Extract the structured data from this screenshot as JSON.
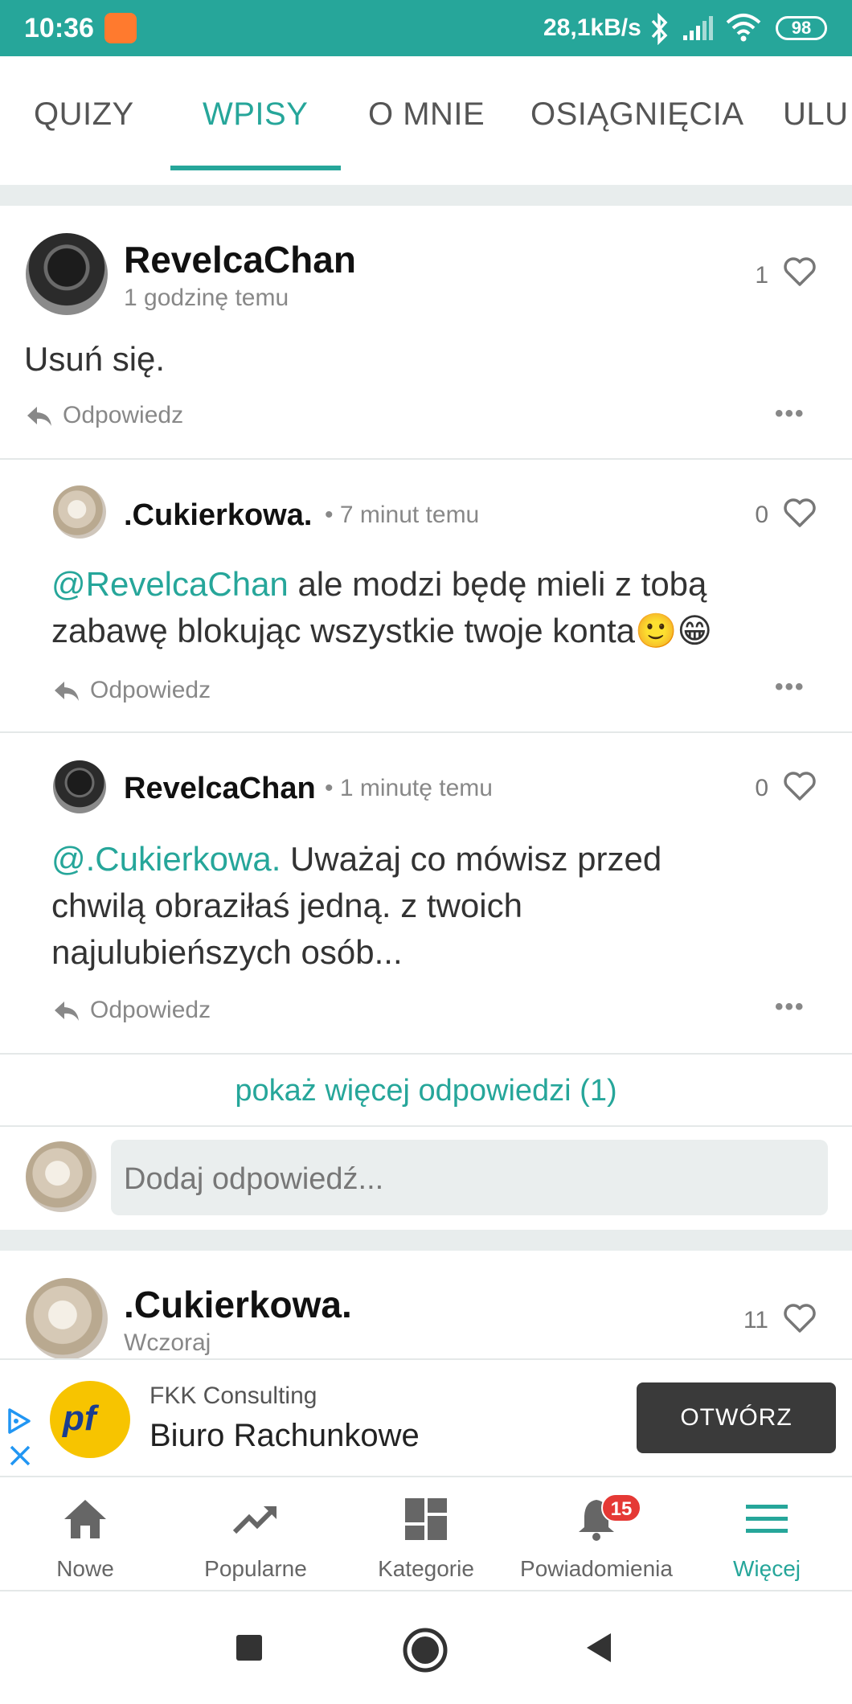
{
  "status_bar": {
    "time": "10:36",
    "network_speed": "28,1kB/s",
    "battery": "98",
    "background_color": "#26a69a"
  },
  "tabs": [
    {
      "label": "QUIZY"
    },
    {
      "label": "WPISY",
      "active": true
    },
    {
      "label": "O MNIE"
    },
    {
      "label": "OSIĄGNIĘCIA"
    },
    {
      "label": "ULU"
    }
  ],
  "post": {
    "author": "RevelcaChan",
    "time": "1 godzinę temu",
    "likes": "1",
    "text": "Usuń się.",
    "reply_label": "Odpowiedz",
    "more_icon": "more-horizontal-icon"
  },
  "replies": [
    {
      "author": ".Cukierkowa.",
      "time": "• 7 minut temu",
      "likes": "0",
      "mention": "@RevelcaChan",
      "text": " ale modzi będę mieli z tobą zabawę blokując wszystkie twoje konta🙂😁",
      "reply_label": "Odpowiedz"
    },
    {
      "author": "RevelcaChan",
      "time": "• 1 minutę temu",
      "likes": "0",
      "mention": "@.Cukierkowa.",
      "text": " Uważaj co mówisz przed chwilą obraziłaś jedną. z twoich najulubieńszych osób...",
      "reply_label": "Odpowiedz"
    }
  ],
  "show_more_replies": "pokaż więcej odpowiedzi (1)",
  "reply_input": {
    "placeholder": "Dodaj odpowiedź..."
  },
  "next_post": {
    "author": ".Cukierkowa.",
    "time": "Wczoraj",
    "likes": "11"
  },
  "ad": {
    "logo_text": "pf",
    "sponsor": "FKK Consulting",
    "title": "Biuro Rachunkowe",
    "cta": "OTWÓRZ"
  },
  "bottom_nav": [
    {
      "label": "Nowe",
      "icon": "home-icon"
    },
    {
      "label": "Popularne",
      "icon": "trending-icon"
    },
    {
      "label": "Kategorie",
      "icon": "dashboard-icon"
    },
    {
      "label": "Powiadomienia",
      "icon": "bell-icon",
      "badge": "15"
    },
    {
      "label": "Więcej",
      "icon": "menu-icon",
      "active": true
    }
  ],
  "colors": {
    "accent": "#26a69a",
    "badge": "#e53935"
  }
}
